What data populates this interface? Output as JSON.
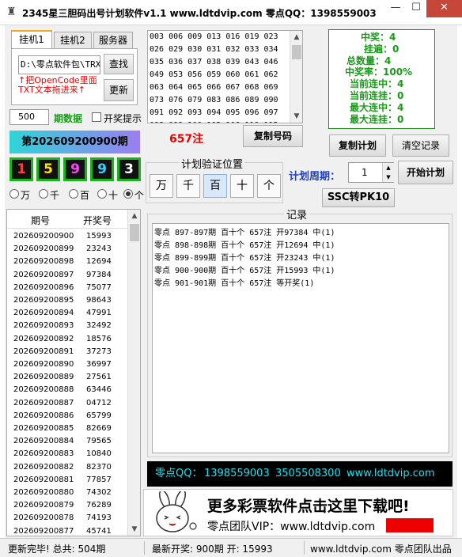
{
  "window": {
    "title": "2345星三胆码出号计划软件v1.1   www.ldtdvip.com   零点QQ：1398559003",
    "minimize": "—",
    "maximize": "☐",
    "close": "✕"
  },
  "tabs": [
    "挂机1",
    "挂机2",
    "服务器"
  ],
  "panel": {
    "path_value": "D:\\零点软件包\\TRX",
    "hint_line1": "↑把OpenCode里面",
    "hint_line2": "TXT文本拖进来↑",
    "find_button": "查找",
    "update_button": "更新"
  },
  "count": {
    "value": "500",
    "label": "期数据",
    "checkbox_label": "开奖提示"
  },
  "current_period": "第202609200900期",
  "digits": [
    {
      "value": "1",
      "color": "#ff3b3b"
    },
    {
      "value": "5",
      "color": "#ffe400"
    },
    {
      "value": "9",
      "color": "#ff44ff"
    },
    {
      "value": "9",
      "color": "#2cd6ff"
    },
    {
      "value": "3",
      "color": "#ffffff"
    }
  ],
  "positions": {
    "options": [
      "万",
      "千",
      "百",
      "十",
      "个"
    ],
    "selected": "个"
  },
  "history": {
    "headers": [
      "期号",
      "开奖号"
    ],
    "rows": [
      [
        "202609200900",
        "15993"
      ],
      [
        "202609200899",
        "23243"
      ],
      [
        "202609200898",
        "12694"
      ],
      [
        "202609200897",
        "97384"
      ],
      [
        "202609200896",
        "75077"
      ],
      [
        "202609200895",
        "98643"
      ],
      [
        "202609200894",
        "47991"
      ],
      [
        "202609200893",
        "32492"
      ],
      [
        "202609200892",
        "18576"
      ],
      [
        "202609200891",
        "37273"
      ],
      [
        "202609200890",
        "36997"
      ],
      [
        "202609200889",
        "27561"
      ],
      [
        "202609200888",
        "63446"
      ],
      [
        "202609200887",
        "04712"
      ],
      [
        "202609200886",
        "65799"
      ],
      [
        "202609200885",
        "82669"
      ],
      [
        "202609200884",
        "79565"
      ],
      [
        "202609200883",
        "10840"
      ],
      [
        "202609200882",
        "82370"
      ],
      [
        "202609200881",
        "77857"
      ],
      [
        "202609200880",
        "74302"
      ],
      [
        "202609200879",
        "76289"
      ],
      [
        "202609200878",
        "74193"
      ],
      [
        "202609200877",
        "45741"
      ]
    ]
  },
  "numbers_lines": [
    "003 006 009 013 016 019 023",
    "026 029 030 031 032 033 034",
    "035 036 037 038 039 043 046",
    "049 053 056 059 060 061 062",
    "063 064 065 066 067 068 069",
    "073 076 079 083 086 089 090",
    "091 092 093 094 095 096 097",
    "098 099 100 103 106 110 112"
  ],
  "stats": [
    "中奖：4",
    "挂遍：0",
    "总数量：4",
    "中奖率：100%",
    "当前连中：4",
    "当前连挂：0",
    "最大连中：4",
    "最大连挂：0"
  ],
  "zhu_count": "657注",
  "buttons": {
    "copy_numbers": "复制号码",
    "copy_plan": "复制计划",
    "clear_log": "清空记录",
    "start_plan": "开始计划",
    "ssc_pk10": "SSC转PK10"
  },
  "verify": {
    "title": "计划验证位置",
    "options": [
      "万",
      "千",
      "百",
      "十",
      "个"
    ],
    "selected": "百"
  },
  "cycle": {
    "label": "计划周期：",
    "value": "1"
  },
  "log": {
    "title": "记录",
    "lines": [
      "零点 897-897期 百十个 657注  开97384 中(1)",
      "零点 898-898期 百十个 657注  开12694 中(1)",
      "零点 899-899期 百十个 657注  开23243 中(1)",
      "零点 900-900期 百十个 657注  开15993 中(1)",
      "零点 901-901期 百十个 657注  等开奖(1)"
    ]
  },
  "contact": {
    "qq_label": "零点QQ：",
    "qq1": "1398559003",
    "qq2": "3505508300",
    "site": "www.ldtdvip.com"
  },
  "ad": {
    "headline": "更多彩票软件点击这里下载吧!",
    "sub": "零点团队VIP：www.ldtdvip.com",
    "tag": "零点团队"
  },
  "status": {
    "left": "更新完毕! 总共: 504期",
    "middle": "最新开奖: 900期 开: 15993",
    "right": "www.ldtdvip.com 零点团队出品"
  },
  "colors": {
    "accent_green": "#1a9a1a",
    "red": "#ee0000",
    "blue": "#1a3ec9",
    "cyan_text": "#1de2f2"
  }
}
